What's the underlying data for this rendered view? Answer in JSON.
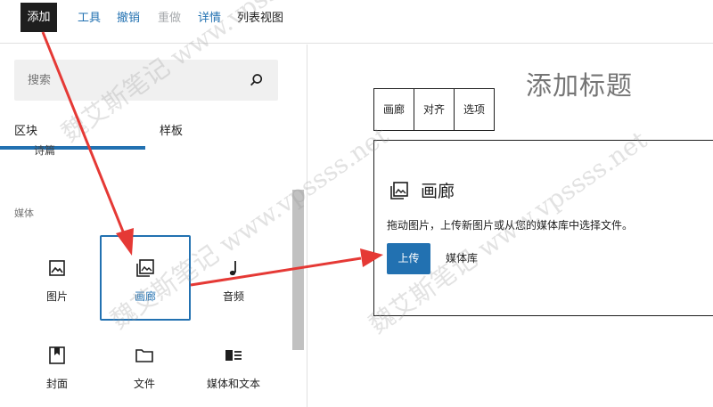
{
  "toolbar": {
    "add_label": "添加",
    "tools_label": "工具",
    "undo_label": "撤销",
    "redo_label": "重做",
    "details_label": "详情",
    "list_view_label": "列表视图"
  },
  "inserter": {
    "search_placeholder": "搜索",
    "tabs": [
      {
        "label": "区块"
      },
      {
        "label": "样板"
      }
    ],
    "partial_label": "诗篇",
    "category": "媒体",
    "blocks": [
      {
        "label": "图片",
        "icon": "image-icon"
      },
      {
        "label": "画廊",
        "icon": "gallery-icon"
      },
      {
        "label": "音频",
        "icon": "audio-icon"
      },
      {
        "label": "封面",
        "icon": "cover-icon"
      },
      {
        "label": "文件",
        "icon": "file-icon"
      },
      {
        "label": "媒体和文本",
        "icon": "media-text-icon"
      }
    ]
  },
  "editor": {
    "title_placeholder": "添加标题",
    "block_toolbar": [
      "画廊",
      "对齐",
      "选项"
    ],
    "gallery": {
      "title": "画廊",
      "description": "拖动图片，上传新图片或从您的媒体库中选择文件。",
      "upload_label": "上传",
      "media_library_label": "媒体库"
    }
  },
  "watermark": {
    "text": "魏艾斯笔记 www.vpssss.net"
  },
  "colors": {
    "accent": "#2271b1",
    "arrow": "#e53935",
    "dark": "#1e1e1e"
  }
}
